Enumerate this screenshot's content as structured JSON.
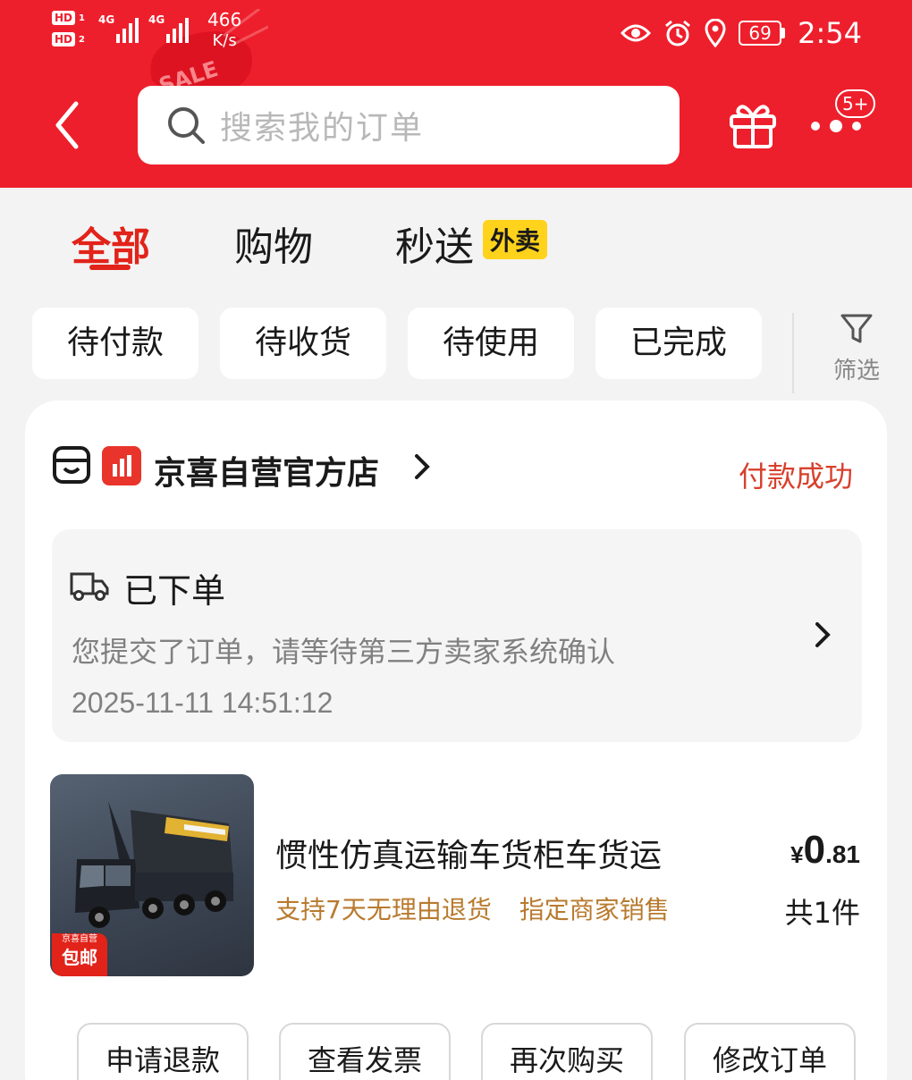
{
  "status_bar": {
    "hd1": "HD",
    "hd1_sub": "1",
    "hd2": "HD",
    "hd2_sub": "2",
    "sig1": "4G",
    "sig2": "4G",
    "net_speed_value": "466",
    "net_speed_unit": "K/s",
    "battery": "69",
    "time": "2:54"
  },
  "header": {
    "sale_text": "SALE",
    "search_placeholder": "搜索我的订单",
    "badge": "5+"
  },
  "tabs": [
    {
      "label": "全部",
      "active": true
    },
    {
      "label": "购物",
      "active": false
    },
    {
      "label": "秒送",
      "active": false
    }
  ],
  "tab_badge": "外卖",
  "status_chips": [
    "待付款",
    "待收货",
    "待使用",
    "已完成"
  ],
  "filter_label": "筛选",
  "order": {
    "store_name": "京喜自营官方店",
    "status": "付款成功",
    "tracking": {
      "title": "已下单",
      "description": "您提交了订单，请等待第三方卖家系统确认",
      "time": "2025-11-11 14:51:12"
    },
    "product": {
      "tag_line1": "京喜自营",
      "tag_line2": "包邮",
      "title": "惯性仿真运输车货柜车货运",
      "service_tags": [
        "支持7天无理由退货",
        "指定商家销售"
      ],
      "price_currency": "¥",
      "price_int": "0",
      "price_dec": ".81",
      "quantity": "共1件"
    },
    "actions": [
      "申请退款",
      "查看发票",
      "再次购买",
      "修改订单"
    ]
  },
  "colors": {
    "header_red": "#ee1f2c",
    "active_tab": "#e2231a",
    "status_red": "#d8402c",
    "service_tag": "#b87a2e",
    "waimai_yellow": "#ffd31c"
  }
}
